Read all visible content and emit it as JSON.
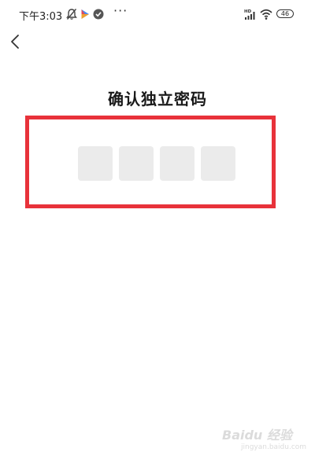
{
  "status_bar": {
    "time": "下午3:03",
    "more": "···",
    "battery": "46",
    "icons": [
      "alarm-off-icon",
      "play-app-icon",
      "check-badge-icon",
      "hd-signal-icon",
      "wifi-icon",
      "battery-icon"
    ]
  },
  "nav": {
    "back_icon": "chevron-left-icon"
  },
  "page": {
    "title": "确认独立密码"
  },
  "pin": {
    "length": 4,
    "filled": 0
  },
  "colors": {
    "highlight": "#e8323a",
    "pin_box": "#ebebeb",
    "title": "#1a1a1a"
  },
  "watermark": {
    "brand": "Baidu 经验",
    "sub": "jingyan.baidu.com"
  }
}
